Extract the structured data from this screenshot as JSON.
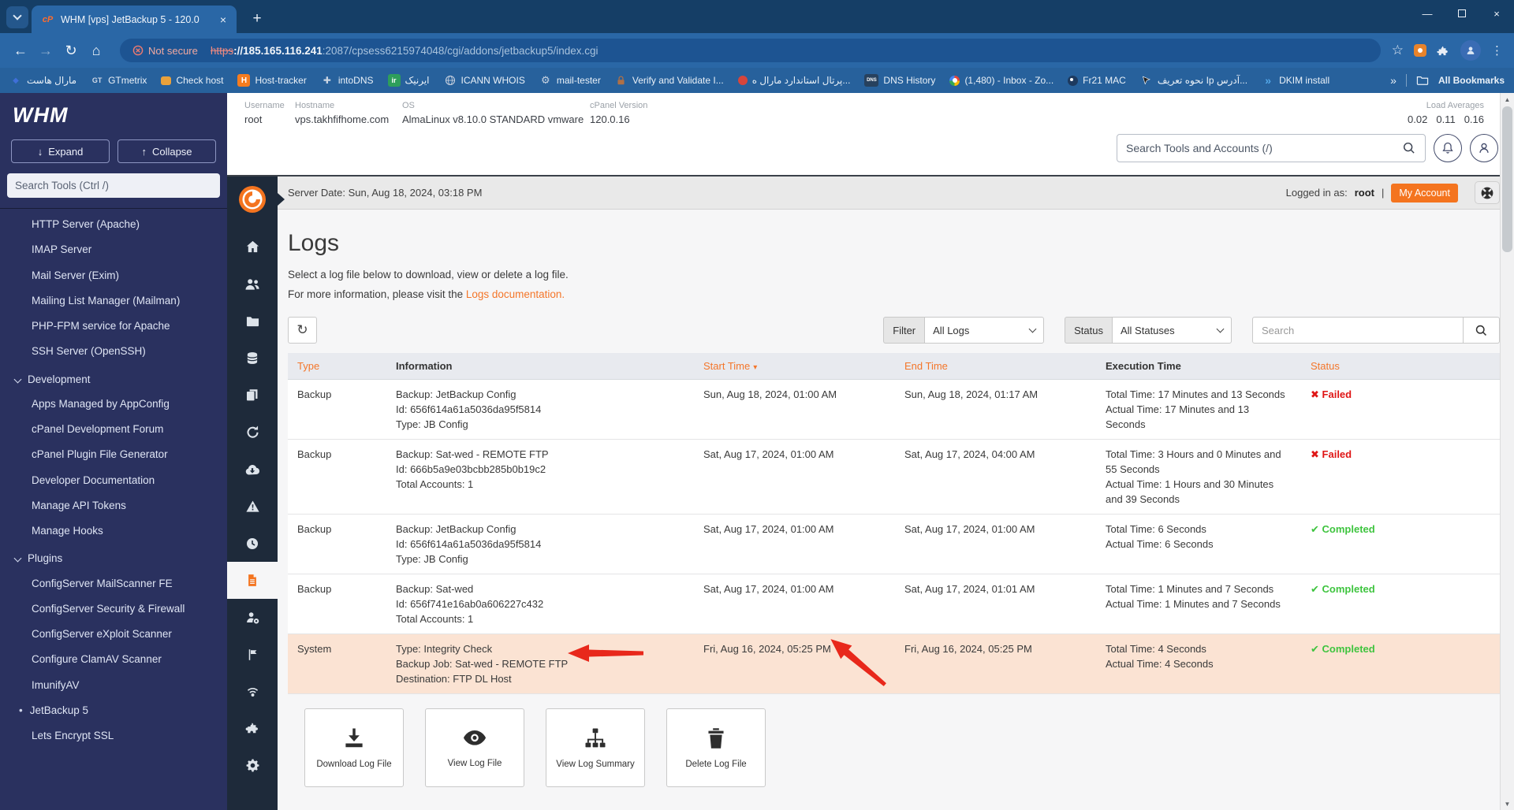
{
  "colors": {
    "accent_orange": "#f4741f",
    "link_orange": "#f4762a",
    "whm_navy": "#2a315f",
    "rail_dark": "#1e2a3a",
    "chrome_frame": "#153e66",
    "chrome_toolbar": "#2a67a6",
    "failed_red": "#df1616",
    "completed_green": "#3fc43f",
    "selected_row_bg": "#fbe3d3",
    "annotation_red": "#e8281b"
  },
  "glyphs": {
    "back": "←",
    "forward": "→",
    "reload": "↻",
    "home": "⌂",
    "star": "☆",
    "kebab": "⋮",
    "plus": "+",
    "close_tab": "×",
    "minimize": "—",
    "close_win": "×",
    "overflow": "»",
    "sort_desc": "▾",
    "bullet": "•",
    "scroll_up": "▲",
    "scroll_down": "▼",
    "expand_arrow": "↓",
    "collapse_arrow": "↑"
  },
  "browser": {
    "tab_title": "WHM [vps] JetBackup 5 - 120.0",
    "favicon_text": "cP",
    "security_chip": "Not secure",
    "url": {
      "scheme": "https",
      "host": "://185.165.116.241",
      "path": ":2087/cpsess6215974048/cgi/addons/jetbackup5/index.cgi"
    },
    "window_controls": [
      "minimize",
      "maximize",
      "close"
    ],
    "bookmarks": [
      {
        "label": "مارال هاست",
        "icon": "maral-host-icon"
      },
      {
        "label": "GTmetrix",
        "icon": "gtmetrix-icon"
      },
      {
        "label": "Check host",
        "icon": "check-host-icon"
      },
      {
        "label": "Host-tracker",
        "icon": "host-tracker-icon"
      },
      {
        "label": "intoDNS",
        "icon": "intodns-icon"
      },
      {
        "label": "ایرنیک",
        "icon": "irnic-icon"
      },
      {
        "label": "ICANN WHOIS",
        "icon": "globe-icon"
      },
      {
        "label": "mail-tester",
        "icon": "gear-icon"
      },
      {
        "label": "Verify and Validate I...",
        "icon": "lock-icon"
      },
      {
        "label": "پرتال استاندارد مارال ه...",
        "icon": "portal-icon"
      },
      {
        "label": "DNS History",
        "icon": "dns-history-icon"
      },
      {
        "label": "(1,480) - Inbox - Zo...",
        "icon": "inbox-icon"
      },
      {
        "label": "Fr21 MAC",
        "icon": "fr21-icon"
      },
      {
        "label": "نحوه تعریف Ip آدرس...",
        "icon": "cursor-icon"
      },
      {
        "label": "DKIM install",
        "icon": "dkim-icon"
      }
    ],
    "gt_initials": "GT",
    "ir_initials": "ir",
    "h_initial": "H",
    "dns_initials": "DNS",
    "all_bookmarks_label": "All Bookmarks"
  },
  "whm": {
    "logo": "WHM",
    "server_info": {
      "username_label": "Username",
      "username": "root",
      "hostname_label": "Hostname",
      "hostname": "vps.takhfifhome.com",
      "os_label": "OS",
      "os": "AlmaLinux v8.10.0 STANDARD vmware",
      "cpanel_label": "cPanel Version",
      "cpanel_version": "120.0.16"
    },
    "load": {
      "label": "Load Averages",
      "v1": "0.02",
      "v2": "0.11",
      "v3": "0.16"
    },
    "header_search_placeholder": "Search Tools and Accounts (/)",
    "sidebar": {
      "expand_label": "Expand",
      "collapse_label": "Collapse",
      "search_placeholder": "Search Tools (Ctrl /)",
      "items": [
        {
          "label": "HTTP Server (Apache)",
          "type": "item"
        },
        {
          "label": "IMAP Server",
          "type": "item"
        },
        {
          "label": "Mail Server (Exim)",
          "type": "item"
        },
        {
          "label": "Mailing List Manager (Mailman)",
          "type": "item"
        },
        {
          "label": "PHP-FPM service for Apache",
          "type": "item"
        },
        {
          "label": "SSH Server (OpenSSH)",
          "type": "item"
        },
        {
          "label": "Development",
          "type": "group"
        },
        {
          "label": "Apps Managed by AppConfig",
          "type": "item"
        },
        {
          "label": "cPanel Development Forum",
          "type": "item"
        },
        {
          "label": "cPanel Plugin File Generator",
          "type": "item"
        },
        {
          "label": "Developer Documentation",
          "type": "item"
        },
        {
          "label": "Manage API Tokens",
          "type": "item"
        },
        {
          "label": "Manage Hooks",
          "type": "item"
        },
        {
          "label": "Plugins",
          "type": "group"
        },
        {
          "label": "ConfigServer MailScanner FE",
          "type": "item"
        },
        {
          "label": "ConfigServer Security & Firewall",
          "type": "item"
        },
        {
          "label": "ConfigServer eXploit Scanner",
          "type": "item"
        },
        {
          "label": "Configure ClamAV Scanner",
          "type": "item"
        },
        {
          "label": "ImunifyAV",
          "type": "item"
        },
        {
          "label": "JetBackup 5",
          "type": "item",
          "active": true
        },
        {
          "label": "Lets Encrypt SSL",
          "type": "item"
        }
      ]
    }
  },
  "jetbackup": {
    "server_date": "Server Date: Sun, Aug 18, 2024, 03:18 PM",
    "logged_in_prefix": "Logged in as:",
    "logged_in_user": "root",
    "logged_in_sep": "|",
    "my_account": "My Account",
    "rail_icons": [
      "jetbackup-logo",
      "home-icon",
      "accounts-icon",
      "file-manager-icon",
      "backup-jobs-icon",
      "clone-jobs-icon",
      "restore-icon",
      "downloads-icon",
      "alerts-icon",
      "queue-icon",
      "logs-icon",
      "account-management-icon",
      "destinations-icon",
      "schedules-icon",
      "plugins-icon",
      "settings-icon"
    ],
    "page": {
      "title": "Logs",
      "subtitle": "Select a log file below to download, view or delete a log file.",
      "info_prefix": "For more information, please visit the ",
      "info_link": "Logs documentation.",
      "filter_label": "Filter",
      "filter_value": "All Logs",
      "status_label": "Status",
      "status_value": "All Statuses",
      "search_placeholder": "Search",
      "table": {
        "headers": [
          "Type",
          "Information",
          "Start Time",
          "End Time",
          "Execution Time",
          "Status"
        ],
        "rows": [
          {
            "type": "Backup",
            "info1": "Backup: JetBackup Config",
            "info2": "Id: 656f614a61a5036da95f5814",
            "info3": "Type: JB Config",
            "start": "Sun, Aug 18, 2024, 01:00 AM",
            "end": "Sun, Aug 18, 2024, 01:17 AM",
            "exec1": "Total Time: 17 Minutes and 13 Seconds",
            "exec2": "Actual Time: 17 Minutes and 13 Seconds",
            "status_icon": "✖",
            "status_label": "Failed",
            "state": "failed"
          },
          {
            "type": "Backup",
            "info1": "Backup: Sat-wed - REMOTE FTP",
            "info2": "Id: 666b5a9e03bcbb285b0b19c2",
            "info3": "Total Accounts: 1",
            "start": "Sat, Aug 17, 2024, 01:00 AM",
            "end": "Sat, Aug 17, 2024, 04:00 AM",
            "exec1": "Total Time: 3 Hours and 0 Minutes and 55 Seconds",
            "exec2": "Actual Time: 1 Hours and 30 Minutes and 39 Seconds",
            "status_icon": "✖",
            "status_label": "Failed",
            "state": "failed"
          },
          {
            "type": "Backup",
            "info1": "Backup: JetBackup Config",
            "info2": "Id: 656f614a61a5036da95f5814",
            "info3": "Type: JB Config",
            "start": "Sat, Aug 17, 2024, 01:00 AM",
            "end": "Sat, Aug 17, 2024, 01:00 AM",
            "exec1": "Total Time: 6 Seconds",
            "exec2": "Actual Time: 6 Seconds",
            "status_icon": "✔",
            "status_label": "Completed",
            "state": "completed"
          },
          {
            "type": "Backup",
            "info1": "Backup: Sat-wed",
            "info2": "Id: 656f741e16ab0a606227c432",
            "info3": "Total Accounts: 1",
            "start": "Sat, Aug 17, 2024, 01:00 AM",
            "end": "Sat, Aug 17, 2024, 01:01 AM",
            "exec1": "Total Time: 1 Minutes and 7 Seconds",
            "exec2": "Actual Time: 1 Minutes and 7 Seconds",
            "status_icon": "✔",
            "status_label": "Completed",
            "state": "completed"
          },
          {
            "type": "System",
            "info1": "Type: Integrity Check",
            "info2": "Backup Job: Sat-wed - REMOTE FTP",
            "info3": "Destination: FTP DL Host",
            "start": "Fri, Aug 16, 2024, 05:25 PM",
            "end": "Fri, Aug 16, 2024, 05:25 PM",
            "exec1": "Total Time: 4 Seconds",
            "exec2": "Actual Time: 4 Seconds",
            "status_icon": "✔",
            "status_label": "Completed",
            "state": "completed",
            "highlighted": true
          }
        ]
      },
      "actions": [
        {
          "label": "Download Log File",
          "icon": "download-icon"
        },
        {
          "label": "View Log File",
          "icon": "eye-icon"
        },
        {
          "label": "View Log Summary",
          "icon": "sitemap-icon"
        },
        {
          "label": "Delete Log File",
          "icon": "trash-icon"
        }
      ]
    }
  }
}
